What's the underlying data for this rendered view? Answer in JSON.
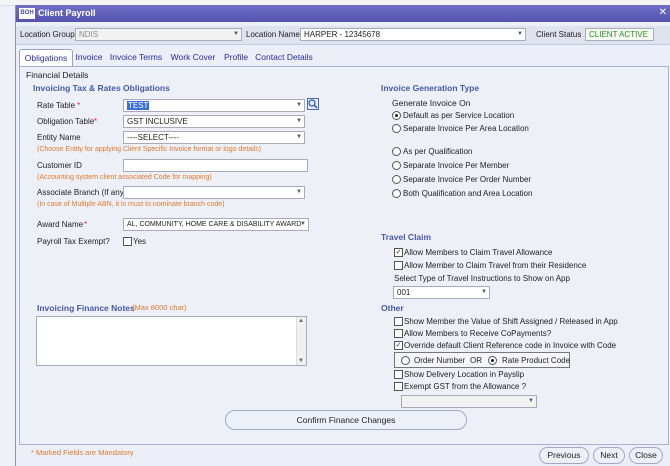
{
  "window": {
    "title": "Client Payroll",
    "logo": "BOH"
  },
  "location_bar": {
    "group_label": "Location Group",
    "group_value": "NDIS",
    "name_label": "Location Name",
    "name_value": "HARPER - 12345678",
    "status_label": "Client Status",
    "status_value": "CLIENT ACTIVE"
  },
  "tabs": [
    "Obligations",
    "Invoice",
    "Invoice Terms",
    "Work Cover",
    "Profile",
    "Contact Details"
  ],
  "panel": {
    "title": "Financial Details"
  },
  "left": {
    "section_title": "Invoicing Tax & Rates Obligations",
    "rate_table_label": "Rate Table",
    "rate_table_value": "TEST",
    "obligation_table_label": "Obligation Table",
    "obligation_table_value": "GST INCLUSIVE",
    "entity_name_label": "Entity Name",
    "entity_name_value": "----SELECT----",
    "entity_hint": "(Choose Entity for applying Client Specific Invoice format or logo details)",
    "customer_id_label": "Customer ID",
    "customer_id_value": "",
    "customer_id_hint": "(Accounting system client associated Code for mapping)",
    "associate_branch_label": "Associate Branch (If any)",
    "associate_branch_value": "",
    "associate_branch_hint": "(In case of Multiple ABN, it is must to nominate branch code)",
    "award_name_label": "Award Name",
    "award_name_value": "AL, COMMUNITY, HOME CARE & DISABILITY AWARD",
    "payroll_tax_label": "Payroll Tax Exempt?",
    "payroll_tax_yes": "Yes",
    "required_mark": "*"
  },
  "notes": {
    "title": "Invoicing Finance Notes",
    "max_hint": "(Max 8000 char)",
    "value": ""
  },
  "invoice_gen": {
    "section_title": "Invoice Generation Type",
    "generate_label": "Generate Invoice On",
    "opt_service": "Default as per Service Location",
    "opt_area": "Separate Invoice Per Area Location",
    "opt_qual": "As per Qualification",
    "opt_member": "Separate Invoice Per Member",
    "opt_order": "Separate Invoice Per Order Number",
    "opt_both": "Both Qualification and Area Location",
    "selected": "opt_service"
  },
  "travel": {
    "section_title": "Travel Claim",
    "allow_allowance": "Allow Members to Claim Travel Allowance",
    "allow_residence": "Allow Member to Claim Travel from their Residence",
    "select_type_label": "Select Type of Travel Instructions to Show on App",
    "select_type_value": "001"
  },
  "other": {
    "section_title": "Other",
    "show_value": "Show Member the Value of Shift Assigned / Released in App",
    "copayments": "Allow Members to Receive CoPayments?",
    "override_ref": "Override default Client Reference code in Invoice with Code",
    "order_number": "Order Number",
    "or_text": "OR",
    "rate_product_code": "Rate Product Code",
    "delivery_location": "Show Delivery Location in Payslip",
    "exempt_gst": "Exempt GST from the Allowance ?"
  },
  "buttons": {
    "confirm": "Confirm Finance Changes",
    "previous": "Previous",
    "next": "Next",
    "close": "Close"
  },
  "footer": {
    "mandatory_note": "* Marked Fields are Mandatory"
  },
  "colors": {
    "titlebar": "#5552b0",
    "section": "#4758a8",
    "hint": "#e07a2c",
    "status": "#2f8a2f"
  }
}
